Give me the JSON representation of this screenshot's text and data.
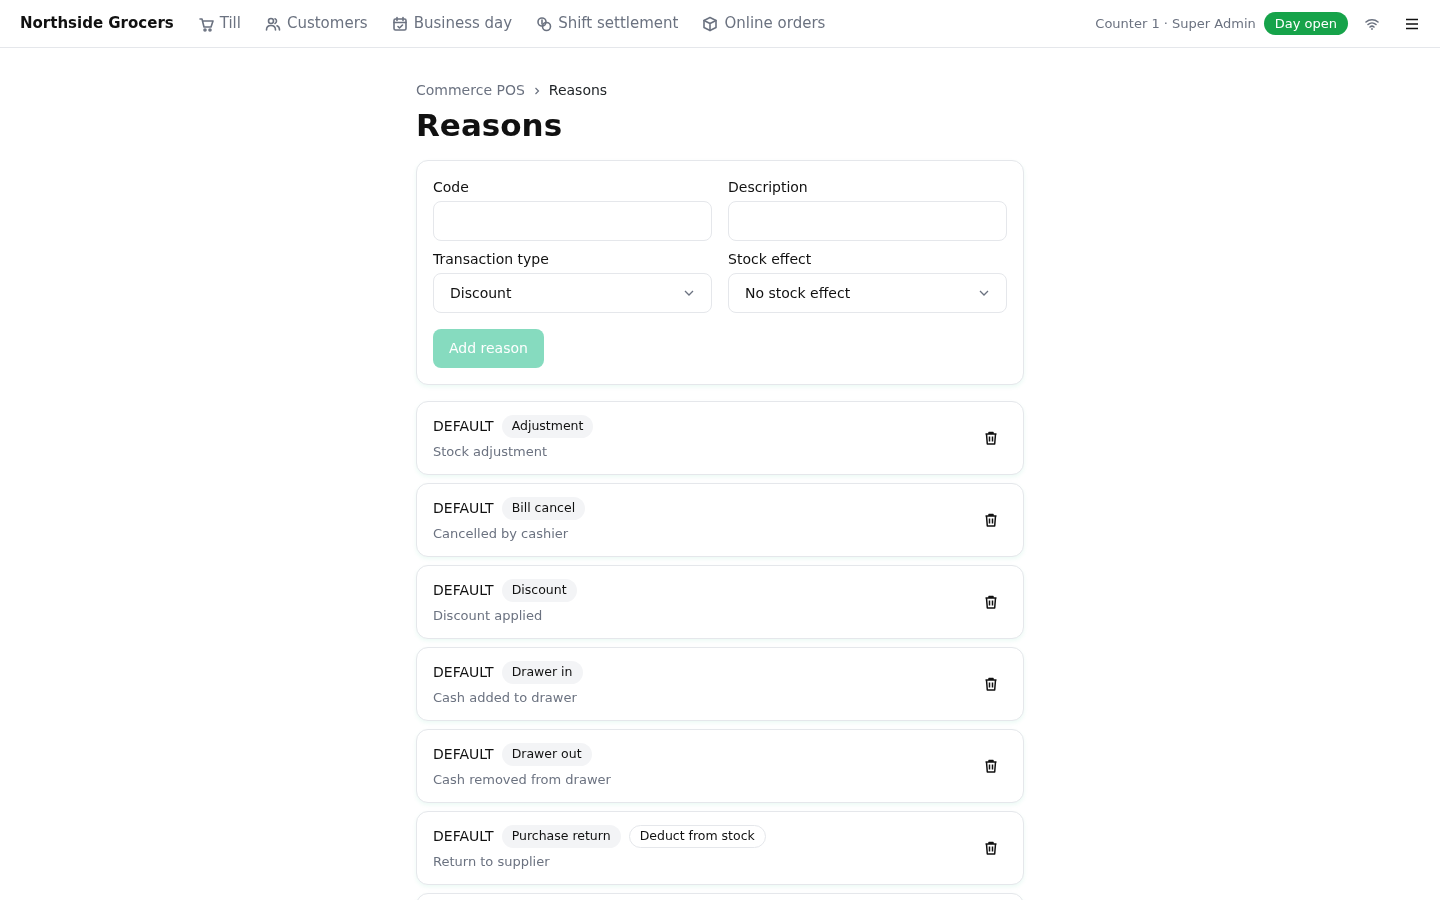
{
  "brand": "Northside Grocers",
  "nav": [
    {
      "label": "Till"
    },
    {
      "label": "Customers"
    },
    {
      "label": "Business day"
    },
    {
      "label": "Shift settlement"
    },
    {
      "label": "Online orders"
    }
  ],
  "session": "Counter 1 · Super Admin",
  "day_status": {
    "label": "Day open",
    "open": true
  },
  "breadcrumb": [
    "Commerce POS",
    "Reasons"
  ],
  "title": "Reasons",
  "form": {
    "fields": [
      {
        "kind": "input",
        "label": "Code"
      },
      {
        "kind": "input",
        "label": "Description"
      },
      {
        "kind": "select",
        "label": "Transaction type",
        "value": "Discount"
      },
      {
        "kind": "select",
        "label": "Stock effect",
        "value": "No stock effect"
      }
    ],
    "button": {
      "label": "Add reason",
      "disabled": true
    }
  },
  "reasons": [
    {
      "code": "DEFAULT",
      "type": "Adjustment",
      "description": "Stock adjustment"
    },
    {
      "code": "DEFAULT",
      "type": "Bill cancel",
      "description": "Cancelled by cashier"
    },
    {
      "code": "DEFAULT",
      "type": "Discount",
      "description": "Discount applied"
    },
    {
      "code": "DEFAULT",
      "type": "Drawer in",
      "description": "Cash added to drawer"
    },
    {
      "code": "DEFAULT",
      "type": "Drawer out",
      "description": "Cash removed from drawer"
    },
    {
      "code": "DEFAULT",
      "type": "Purchase return",
      "stock_effect": "Deduct from stock",
      "description": "Return to supplier"
    }
  ]
}
